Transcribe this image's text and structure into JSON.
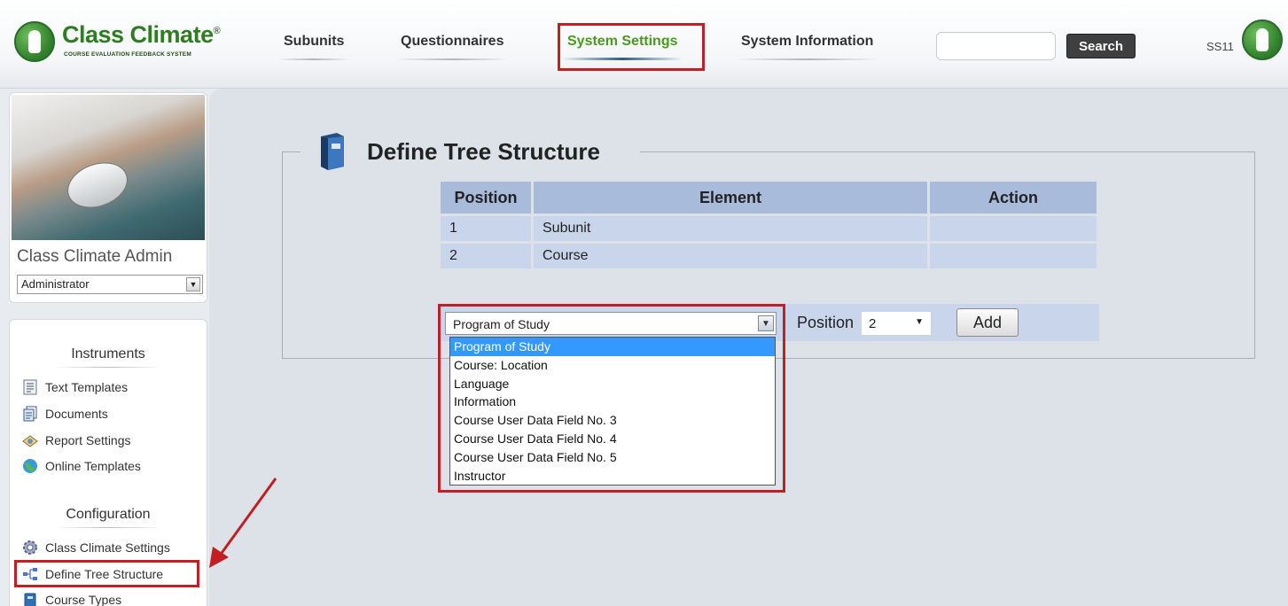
{
  "brand": {
    "name": "Class Climate",
    "registered": "®",
    "tagline": "COURSE EVALUATION FEEDBACK SYSTEM"
  },
  "topnav": [
    {
      "label": "Subunits"
    },
    {
      "label": "Questionnaires"
    },
    {
      "label": "System Settings",
      "active": true
    },
    {
      "label": "System Information"
    }
  ],
  "search": {
    "value": "",
    "button_label": "Search"
  },
  "user": {
    "code": "SS11"
  },
  "profile": {
    "name": "Class Climate Admin",
    "role": "Administrator"
  },
  "sidebar": {
    "instruments_title": "Instruments",
    "instruments": [
      {
        "label": "Text Templates",
        "icon": "text-templates-icon"
      },
      {
        "label": "Documents",
        "icon": "documents-icon"
      },
      {
        "label": "Report Settings",
        "icon": "report-settings-icon"
      },
      {
        "label": "Online Templates",
        "icon": "online-templates-icon"
      }
    ],
    "configuration_title": "Configuration",
    "configuration": [
      {
        "label": "Class Climate Settings",
        "icon": "gear-icon"
      },
      {
        "label": "Define Tree Structure",
        "icon": "tree-structure-icon",
        "active": true
      },
      {
        "label": "Course Types",
        "icon": "course-types-icon"
      }
    ]
  },
  "main": {
    "title": "Define Tree Structure",
    "table": {
      "headers": [
        "Position",
        "Element",
        "Action"
      ],
      "rows": [
        {
          "position": "1",
          "element": "Subunit",
          "action": ""
        },
        {
          "position": "2",
          "element": "Course",
          "action": ""
        }
      ]
    },
    "add_form": {
      "element_selected": "Program of Study",
      "element_options": [
        "Program of Study",
        "Course: Location",
        "Language",
        "Information",
        "Course User Data Field No. 3",
        "Course User Data Field No. 4",
        "Course User Data Field No. 5",
        "Instructor"
      ],
      "position_label": "Position",
      "position_value": "2",
      "add_label": "Add"
    }
  },
  "colors": {
    "accent_green": "#4a9a1f",
    "highlight_red": "#c21f25",
    "table_header": "#a9bbdb",
    "table_cell": "#c9d5eb"
  }
}
